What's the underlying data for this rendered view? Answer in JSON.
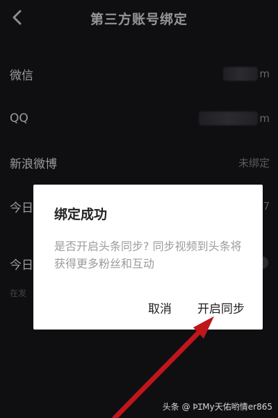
{
  "header": {
    "title": "第三方账号绑定",
    "back_icon": "chevron-left-icon"
  },
  "rows": [
    {
      "label": "微信",
      "value_suffix": "m"
    },
    {
      "label": "QQ",
      "value_suffix": "m"
    },
    {
      "label": "新浪微博",
      "value": "未绑定"
    },
    {
      "label": "今日",
      "value_suffix": "7"
    },
    {
      "label": "今日"
    }
  ],
  "sub_note": "在发",
  "dialog": {
    "title": "绑定成功",
    "message": "是否开启头条同步? 同步视频到头条将获得更多粉丝和互动",
    "cancel_label": "取消",
    "confirm_label": "开启同步"
  },
  "watermark": "头条 @ ÞꞮMy天佑哟情er865",
  "colors": {
    "background": "#141418",
    "dialog": "#ffffff",
    "arrow": "#c0161b"
  }
}
